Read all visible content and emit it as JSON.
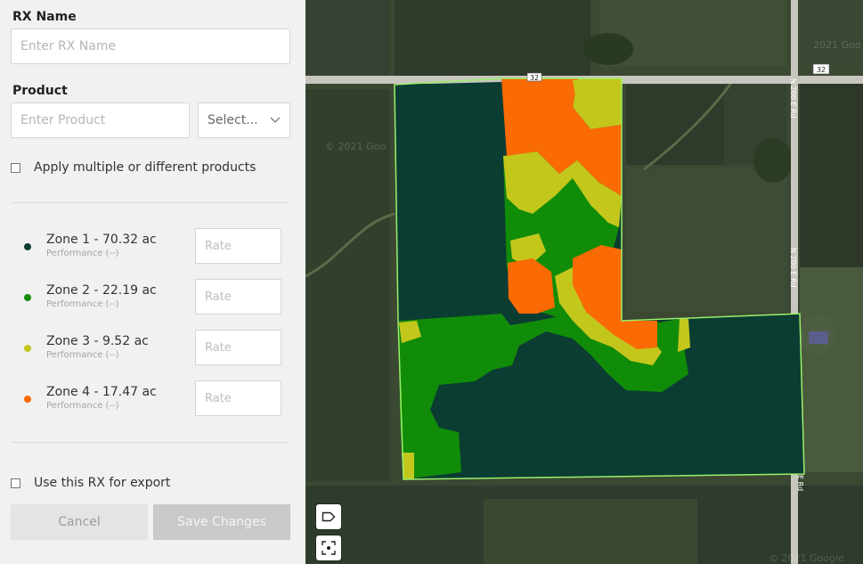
{
  "form": {
    "rx_name_label": "RX Name",
    "rx_name_placeholder": "Enter RX Name",
    "product_label": "Product",
    "product_placeholder": "Enter Product",
    "product_select_value": "Select...",
    "apply_multiple_label": "Apply multiple or different products",
    "export_label": "Use this RX for export",
    "cancel_label": "Cancel",
    "save_label": "Save Changes"
  },
  "zones": [
    {
      "name": "Zone 1 - 70.32 ac",
      "performance": "Performance (--)",
      "rate_placeholder": "Rate",
      "color": "#0b3d32"
    },
    {
      "name": "Zone 2 - 22.19 ac",
      "performance": "Performance (--)",
      "rate_placeholder": "Rate",
      "color": "#118c08"
    },
    {
      "name": "Zone 3 - 9.52 ac",
      "performance": "Performance (--)",
      "rate_placeholder": "Rate",
      "color": "#c3c71c"
    },
    {
      "name": "Zone 4 - 17.47 ac",
      "performance": "Performance (--)",
      "rate_placeholder": "Rate",
      "color": "#fa6a05"
    }
  ],
  "map": {
    "road_shield_top": "32",
    "road_shield_right": "32",
    "road_label_north": "N 200 E Rd",
    "road_label_middle": "N 200 E Rd",
    "road_label_south": "E Rd",
    "watermark_top": "© 2021 Goo",
    "watermark_right": "2021 Goo",
    "watermark_bottom": "© 2021 Google",
    "label_icon": "label-tag-icon",
    "locate_icon": "focus-locate-icon"
  }
}
